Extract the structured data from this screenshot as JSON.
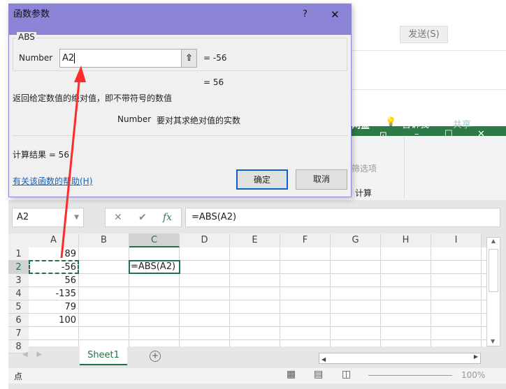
{
  "background": {
    "send_button": "发送(S)",
    "excel_tabs": [
      "网盘",
      "告诉我",
      "共享"
    ],
    "ribbon_group": "计算",
    "ribbon_item": "筛选项"
  },
  "dialog": {
    "title": "函数参数",
    "help_glyph": "?",
    "close_glyph": "✕",
    "function_name": "ABS",
    "arg_label": "Number",
    "arg_value": "A2",
    "arg_result": "=  -56",
    "func_result": "=  56",
    "description": "返回给定数值的绝对值，即不带符号的数值",
    "arg_desc_label": "Number",
    "arg_desc": "要对其求绝对值的实数",
    "calc_result": "计算结果 =   56",
    "help_link": "有关该函数的帮助(H)",
    "ok": "确定",
    "cancel": "取消"
  },
  "formula_bar": {
    "name_box": "A2",
    "formula": "=ABS(A2)",
    "cancel_glyph": "✕",
    "enter_glyph": "✔",
    "fx": "fx"
  },
  "columns": [
    "A",
    "B",
    "C",
    "D",
    "E",
    "F",
    "G",
    "H",
    "I"
  ],
  "rows": [
    "1",
    "2",
    "3",
    "4",
    "5",
    "6",
    "7",
    "8"
  ],
  "column_a": [
    "89",
    "-56",
    "56",
    "-135",
    "79",
    "100"
  ],
  "cell_c2": "=ABS(A2)",
  "sheet_tab": "Sheet1",
  "status": {
    "mode": "点",
    "zoom": "100%"
  },
  "colors": {
    "dialog_title": "#8b84d7",
    "excel_green": "#2d7a46",
    "selection": "#217346",
    "arrow": "#ff2a2a"
  }
}
